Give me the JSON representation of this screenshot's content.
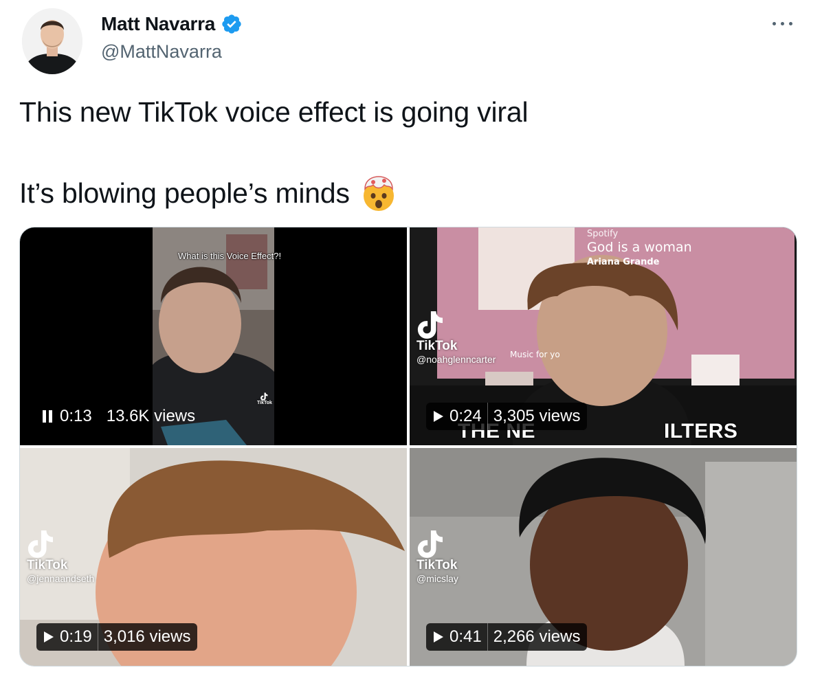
{
  "author": {
    "display_name": "Matt Navarra",
    "handle": "@MattNavarra",
    "verified": true
  },
  "tweet": {
    "line1": "This new TikTok voice effect is going viral",
    "line2": "It’s blowing people’s minds",
    "emoji": "exploding-head"
  },
  "colors": {
    "verified_blue": "#1d9bf0",
    "text": "#0f1419",
    "secondary": "#536471",
    "border": "#cfd9de"
  },
  "videos": [
    {
      "state": "playing",
      "time": "0:13",
      "views": "13.6K views",
      "caption": "What is this Voice Effect?!",
      "brand": "TikTok"
    },
    {
      "state": "paused",
      "time": "0:24",
      "views": "3,305 views",
      "brand": "TikTok",
      "tiktok_handle": "@noahglenncarter",
      "song_title": "God is a woman",
      "song_artist": "Ariana Grande",
      "music_app": "Spotify",
      "music_label": "Music for yo",
      "bottom_left": "THE NE",
      "bottom_right": "ILTERS"
    },
    {
      "state": "paused",
      "time": "0:19",
      "views": "3,016 views",
      "brand": "TikTok",
      "tiktok_handle": "@jennaandseth"
    },
    {
      "state": "paused",
      "time": "0:41",
      "views": "2,266 views",
      "brand": "TikTok",
      "tiktok_handle": "@micslay"
    }
  ]
}
